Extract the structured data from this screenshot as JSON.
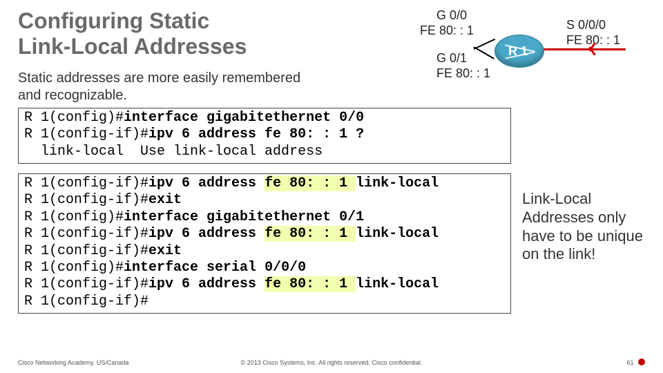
{
  "title_l1": "Configuring Static",
  "title_l2": "Link-Local Addresses",
  "body_l1": "Static addresses are more easily remembered",
  "body_l2": "and recognizable.",
  "diagram": {
    "g00": "G 0/0",
    "g00_addr": "FE 80: : 1",
    "g01": "G 0/1",
    "g01_addr": "FE 80: : 1",
    "s000": "S 0/0/0",
    "s000_addr": "FE 80: : 1",
    "router": "R 1"
  },
  "code1": {
    "l1a": "R 1(config)#",
    "l1b": "interface gigabitethernet 0/0",
    "l2a": "R 1(config-if)#",
    "l2b": "ipv 6 address fe 80: : 1 ?",
    "l3": "  link-local  Use link-local address"
  },
  "code2": {
    "l1a": "R 1(config-if)#",
    "l1b": "ipv 6 address ",
    "l1h": "fe 80: : 1 ",
    "l1c": "link-local",
    "l2a": "R 1(config-if)#",
    "l2b": "exit",
    "l3a": "R 1(config)#",
    "l3b": "interface gigabitethernet 0/1",
    "l4a": "R 1(config-if)#",
    "l4b": "ipv 6 address ",
    "l4h": "fe 80: : 1 ",
    "l4c": "link-local",
    "l5a": "R 1(config-if)#",
    "l5b": "exit",
    "l6a": "R 1(config)#",
    "l6b": "interface serial 0/0/0",
    "l7a": "R 1(config-if)#",
    "l7b": "ipv 6 address ",
    "l7h": "fe 80: : 1 ",
    "l7c": "link-local",
    "l8": "R 1(config-if)#"
  },
  "note_l1": "Link-Local",
  "note_l2": "Addresses only",
  "note_l3": "have to be unique",
  "note_l4": "on the link!",
  "footer": {
    "left": "Cisco Networking Academy, US/Canada",
    "mid": "© 2013 Cisco Systems, Inc. All rights reserved.  Cisco confidential.",
    "right": "61"
  }
}
